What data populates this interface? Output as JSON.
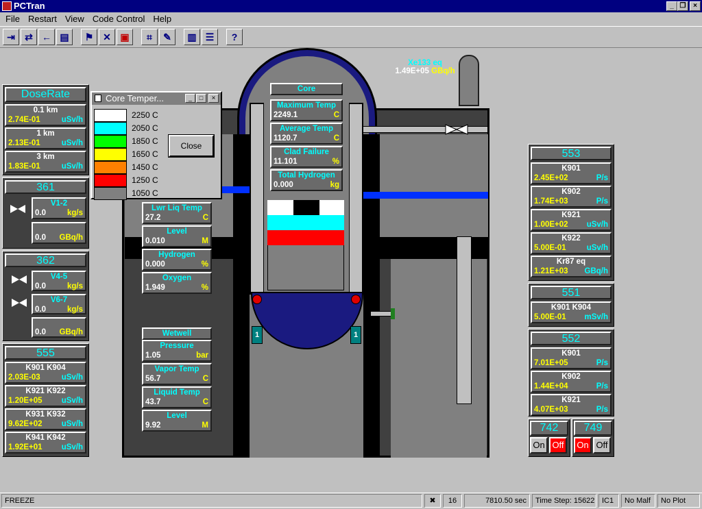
{
  "app": {
    "title": "PCTran"
  },
  "menu": [
    "File",
    "Restart",
    "View",
    "Code Control",
    "Help"
  ],
  "toolbar_icons": [
    "exit-icon",
    "restart-icon",
    "back-arrow-icon",
    "print-icon",
    "run-icon",
    "stop-icon",
    "malfunction-icon",
    "plot-icon",
    "edit-icon",
    "report-icon",
    "list-icon",
    "help-icon"
  ],
  "help_glyph": "?",
  "stack": {
    "label": "Xe133 eq",
    "value": "1.49E+05",
    "unit": "GBq/h"
  },
  "doserate": {
    "title": "DoseRate",
    "rows": [
      {
        "label": "0.1 km",
        "value": "2.74E-01",
        "unit": "uSv/h"
      },
      {
        "label": "1 km",
        "value": "2.13E-01",
        "unit": "uSv/h"
      },
      {
        "label": "3 km",
        "value": "1.83E-01",
        "unit": "uSv/h"
      }
    ]
  },
  "p361": {
    "title": "361",
    "valve": "V1-2",
    "v1": "0.0",
    "u1": "kg/s",
    "v2": "0.0",
    "u2": "GBq/h"
  },
  "p362": {
    "title": "362",
    "valveA": "V4-5",
    "vA": "0.0",
    "uA": "kg/s",
    "valveB": "V6-7",
    "vB": "0.0",
    "uB": "kg/s",
    "v3": "0.0",
    "u3": "GBq/h"
  },
  "p555": {
    "title": "555",
    "rows": [
      {
        "label": "K901  K904",
        "value": "2.03E-03",
        "unit": "uSv/h"
      },
      {
        "label": "K921  K922",
        "value": "1.20E+05",
        "unit": "uSv/h"
      },
      {
        "label": "K931  K932",
        "value": "9.62E+02",
        "unit": "uSv/h"
      },
      {
        "label": "K941  K942",
        "value": "1.92E+01",
        "unit": "uSv/h"
      }
    ]
  },
  "legend": {
    "title": "Core Temper...",
    "items": [
      {
        "color": "#ffffff",
        "label": "2250 C"
      },
      {
        "color": "#00ffff",
        "label": "2050 C"
      },
      {
        "color": "#00ff00",
        "label": "1850 C"
      },
      {
        "color": "#ffff00",
        "label": "1650 C"
      },
      {
        "color": "#ff8000",
        "label": "1450 C"
      },
      {
        "color": "#ff0000",
        "label": "1250 C"
      },
      {
        "color": "#808080",
        "label": "1050 C"
      }
    ],
    "close": "Close"
  },
  "core": {
    "title": "Core",
    "rows": [
      {
        "label": "Maximum Temp",
        "value": "2249.1",
        "unit": "C"
      },
      {
        "label": "Average Temp",
        "value": "1120.7",
        "unit": "C"
      },
      {
        "label": "Clad Failure",
        "value": "11.101",
        "unit": "%"
      },
      {
        "label": "Total Hydrogen",
        "value": "0.000",
        "unit": "kg"
      }
    ]
  },
  "drywell": {
    "rows": [
      {
        "label": "Lwr Liq Temp",
        "value": "27.2",
        "unit": "C"
      },
      {
        "label": "Level",
        "value": "0.010",
        "unit": "M"
      },
      {
        "label": "Hydrogen",
        "value": "0.000",
        "unit": "%"
      },
      {
        "label": "Oxygen",
        "value": "1.949",
        "unit": "%"
      }
    ]
  },
  "wetwell": {
    "title": "Wetwell",
    "rows": [
      {
        "label": "Pressure",
        "value": "1.05",
        "unit": "bar"
      },
      {
        "label": "Vapor Temp",
        "value": "56.7",
        "unit": "C"
      },
      {
        "label": "Liquid Temp",
        "value": "43.7",
        "unit": "C"
      },
      {
        "label": "Level",
        "value": "9.92",
        "unit": "M"
      }
    ]
  },
  "pump_labels": [
    "1",
    "1"
  ],
  "p553": {
    "title": "553",
    "rows": [
      {
        "label": "K901",
        "value": "2.45E+02",
        "unit": "P/s"
      },
      {
        "label": "K902",
        "value": "1.74E+03",
        "unit": "P/s"
      },
      {
        "label": "K921",
        "value": "1.00E+02",
        "unit": "uSv/h"
      },
      {
        "label": "K922",
        "value": "5.00E-01",
        "unit": "uSv/h"
      },
      {
        "label": "Kr87 eq",
        "value": "1.21E+03",
        "unit": "GBq/h"
      }
    ]
  },
  "p551": {
    "title": "551",
    "label": "K901  K904",
    "value": "5.00E-01",
    "unit": "mSv/h"
  },
  "p552": {
    "title": "552",
    "rows": [
      {
        "label": "K901",
        "value": "7.01E+05",
        "unit": "P/s"
      },
      {
        "label": "K902",
        "value": "1.44E+04",
        "unit": "P/s"
      },
      {
        "label": "K921",
        "value": "4.07E+03",
        "unit": "P/s"
      }
    ]
  },
  "p742": {
    "title": "742",
    "on": "On",
    "off": "Off"
  },
  "p749": {
    "title": "749",
    "on": "On",
    "off": "Off"
  },
  "status": {
    "mode": "FREEZE",
    "count": "16",
    "time": "7810.50 sec",
    "step": "Time Step: 15622",
    "ic": "IC1",
    "malf": "No Malf",
    "plot": "No Plot"
  }
}
